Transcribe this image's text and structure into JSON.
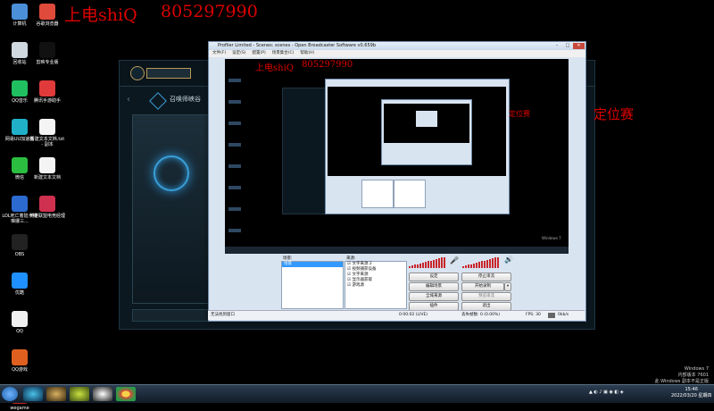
{
  "watermark": {
    "name": "上电shiQ",
    "qq": "805297990",
    "side_text_1": "定位赛",
    "side_text_2": "定位赛"
  },
  "desktop_icons": [
    {
      "label": "计算机",
      "color": "#4a8fd8"
    },
    {
      "label": "谷歌浏览器",
      "color": "#e04a3a"
    },
    {
      "label": "回收站",
      "color": "#cfd7df"
    },
    {
      "label": "剪映专业版",
      "color": "#111111"
    },
    {
      "label": "QQ音乐",
      "color": "#20c060"
    },
    {
      "label": "腾讯手游助手",
      "color": "#e03a3a"
    },
    {
      "label": "网易UU加速器",
      "color": "#20b0c8"
    },
    {
      "label": "新建文本文档.txt - 副本",
      "color": "#f4f4f4"
    },
    {
      "label": "微信",
      "color": "#2bbd40"
    },
    {
      "label": "新建文本文档",
      "color": "#f4f4f4"
    },
    {
      "label": "LOL死亡着陆卡特琳娜三...",
      "color": "#2c6ad0"
    },
    {
      "label": "英雄联盟电竞经理",
      "color": "#d03050"
    },
    {
      "label": "OBS",
      "color": "#222222"
    },
    {
      "label": "优酷",
      "color": "#1e90ff"
    },
    {
      "label": "QQ",
      "color": "#f0f0f0"
    },
    {
      "label": "QQ游戏",
      "color": "#e06020"
    },
    {
      "label": "wegame",
      "color": "#c02020"
    }
  ],
  "lol_client": {
    "menu_label": "召唤师峡谷"
  },
  "obs": {
    "title": "Profiler Limited - Scenes: scenes - Open Broadcaster Software v0.659b",
    "menu": [
      "文件(F)",
      "设定(S)",
      "配置(P)",
      "场景集合(C)",
      "帮助(H)"
    ],
    "scenes_label": "场景:",
    "scenes": [
      "场景"
    ],
    "sources_label": "来源:",
    "sources": [
      "文字来源 2",
      "视频捕获设备",
      "文字来源",
      "显示器获取",
      "游戏源"
    ],
    "buttons": {
      "settings": "设定",
      "stop_stream": "停止串流",
      "edit_scene": "编辑场景",
      "start_record": "开始录制",
      "global_sources": "全域来源",
      "preview_stream": "预览串流",
      "plugins": "插件",
      "exit": "退出"
    },
    "status": {
      "left": "无法找到窗口",
      "time": "0:00:02 (LIVE)",
      "dropped": "丢失帧数: 0 (0.00%)",
      "fps": "FPS: 30",
      "bitrate": "0kb/s"
    }
  },
  "taskbar": {
    "time": "15:46",
    "date": "2022/03/20 星期四",
    "win_text_1": "Windows 7",
    "win_text_2": "内部版本 7601",
    "win_text_3": "此 Windows 副本不是正版"
  }
}
